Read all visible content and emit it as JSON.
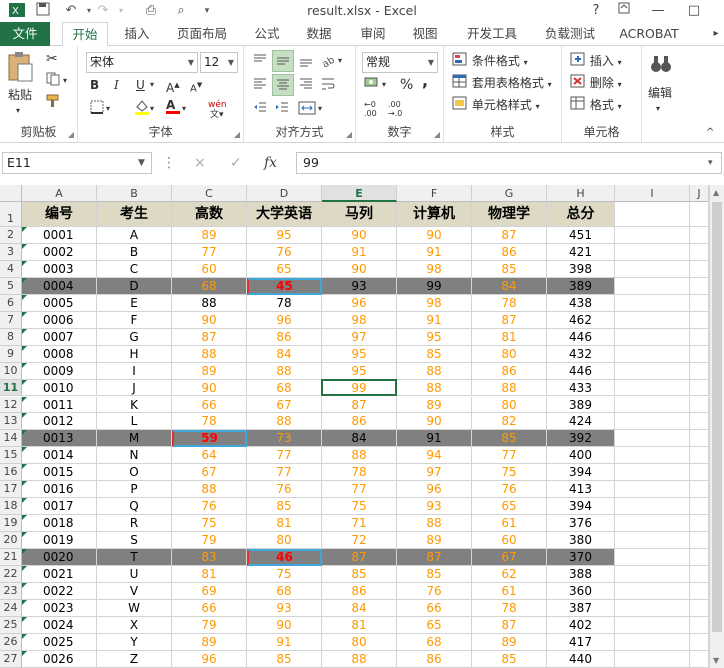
{
  "window": {
    "title": "result.xlsx - Excel",
    "help": "?",
    "restore": "□",
    "minimize": "—"
  },
  "quick_access": {
    "save_icon": "save-icon",
    "undo_icon": "undo-icon",
    "redo_icon": "redo-icon",
    "print_icon": "print-preview-icon",
    "customize_icon": "customize-icon"
  },
  "tabs": [
    "文件",
    "开始",
    "插入",
    "页面布局",
    "公式",
    "数据",
    "审阅",
    "视图",
    "开发工具",
    "负载测试",
    "ACROBAT"
  ],
  "active_tab": "开始",
  "ribbon": {
    "clipboard": {
      "paste": "粘贴",
      "label": "剪贴板"
    },
    "font": {
      "name": "宋体",
      "size": "12",
      "bold": "B",
      "italic": "I",
      "underline": "U",
      "font_color": "A",
      "phonetic": "wén",
      "label": "字体"
    },
    "align": {
      "label": "对齐方式"
    },
    "number": {
      "format": "常规",
      "percent": "%",
      "comma": ",",
      "label": "数字"
    },
    "styles": {
      "cond": "条件格式",
      "table": "套用表格格式",
      "cell": "单元格样式",
      "label": "样式"
    },
    "cells": {
      "insert": "插入",
      "delete": "删除",
      "format": "格式",
      "label": "单元格"
    },
    "edit": {
      "label": "编辑"
    }
  },
  "formula_bar": {
    "name_box": "E11",
    "cancel": "×",
    "enter": "✓",
    "fx": "fx",
    "value": "99"
  },
  "columns": [
    "A",
    "B",
    "C",
    "D",
    "E",
    "F",
    "G",
    "H",
    "I",
    "J"
  ],
  "selected_column": "E",
  "selected_row": "11",
  "headers": [
    "编号",
    "考生",
    "高数",
    "大学英语",
    "马列",
    "计算机",
    "物理学",
    "总分"
  ],
  "rows": [
    {
      "n": "2",
      "c": [
        "0001",
        "A",
        "89",
        "95",
        "90",
        "90",
        "87",
        "451"
      ]
    },
    {
      "n": "3",
      "c": [
        "0002",
        "B",
        "77",
        "76",
        "91",
        "91",
        "86",
        "421"
      ]
    },
    {
      "n": "4",
      "c": [
        "0003",
        "C",
        "60",
        "65",
        "90",
        "98",
        "85",
        "398"
      ]
    },
    {
      "n": "5",
      "c": [
        "0004",
        "D",
        "68",
        "45",
        "93",
        "99",
        "84",
        "389"
      ]
    },
    {
      "n": "6",
      "c": [
        "0005",
        "E",
        "88",
        "78",
        "96",
        "98",
        "78",
        "438"
      ]
    },
    {
      "n": "7",
      "c": [
        "0006",
        "F",
        "90",
        "96",
        "98",
        "91",
        "87",
        "462"
      ]
    },
    {
      "n": "8",
      "c": [
        "0007",
        "G",
        "87",
        "86",
        "97",
        "95",
        "81",
        "446"
      ]
    },
    {
      "n": "9",
      "c": [
        "0008",
        "H",
        "88",
        "84",
        "95",
        "85",
        "80",
        "432"
      ]
    },
    {
      "n": "10",
      "c": [
        "0009",
        "I",
        "89",
        "88",
        "95",
        "88",
        "86",
        "446"
      ]
    },
    {
      "n": "11",
      "c": [
        "0010",
        "J",
        "90",
        "68",
        "99",
        "88",
        "88",
        "433"
      ]
    },
    {
      "n": "12",
      "c": [
        "0011",
        "K",
        "66",
        "67",
        "87",
        "89",
        "80",
        "389"
      ]
    },
    {
      "n": "13",
      "c": [
        "0012",
        "L",
        "78",
        "88",
        "86",
        "90",
        "82",
        "424"
      ]
    },
    {
      "n": "14",
      "c": [
        "0013",
        "M",
        "59",
        "73",
        "84",
        "91",
        "85",
        "392"
      ]
    },
    {
      "n": "15",
      "c": [
        "0014",
        "N",
        "64",
        "77",
        "88",
        "94",
        "77",
        "400"
      ]
    },
    {
      "n": "16",
      "c": [
        "0015",
        "O",
        "67",
        "77",
        "78",
        "97",
        "75",
        "394"
      ]
    },
    {
      "n": "17",
      "c": [
        "0016",
        "P",
        "88",
        "76",
        "77",
        "96",
        "76",
        "413"
      ]
    },
    {
      "n": "18",
      "c": [
        "0017",
        "Q",
        "76",
        "85",
        "75",
        "93",
        "65",
        "394"
      ]
    },
    {
      "n": "19",
      "c": [
        "0018",
        "R",
        "75",
        "81",
        "71",
        "88",
        "61",
        "376"
      ]
    },
    {
      "n": "20",
      "c": [
        "0019",
        "S",
        "79",
        "80",
        "72",
        "89",
        "60",
        "380"
      ]
    },
    {
      "n": "21",
      "c": [
        "0020",
        "T",
        "83",
        "46",
        "87",
        "87",
        "67",
        "370"
      ]
    },
    {
      "n": "22",
      "c": [
        "0021",
        "U",
        "81",
        "75",
        "85",
        "85",
        "62",
        "388"
      ]
    },
    {
      "n": "23",
      "c": [
        "0022",
        "V",
        "69",
        "68",
        "86",
        "76",
        "61",
        "360"
      ]
    },
    {
      "n": "24",
      "c": [
        "0023",
        "W",
        "66",
        "93",
        "84",
        "66",
        "78",
        "387"
      ]
    },
    {
      "n": "25",
      "c": [
        "0024",
        "X",
        "79",
        "90",
        "81",
        "65",
        "87",
        "402"
      ]
    },
    {
      "n": "26",
      "c": [
        "0025",
        "Y",
        "89",
        "91",
        "80",
        "68",
        "89",
        "417"
      ]
    },
    {
      "n": "27",
      "c": [
        "0026",
        "Z",
        "96",
        "85",
        "88",
        "86",
        "85",
        "440"
      ]
    }
  ],
  "highlight_rows": [
    "5",
    "14",
    "21"
  ],
  "failing_cells": [
    {
      "row": "5",
      "col": 3
    },
    {
      "row": "14",
      "col": 2
    },
    {
      "row": "21",
      "col": 3
    }
  ],
  "black_text": {
    "6": [
      2,
      3
    ],
    "5": [
      3,
      4,
      5,
      7
    ],
    "14": [
      4,
      5,
      7
    ]
  },
  "colors": {
    "accent": "#217346",
    "header_fill": "#ddd9c4",
    "highlight_fill": "#808080",
    "pass_color": "#ff9900",
    "fail_color": "#ff0000"
  }
}
